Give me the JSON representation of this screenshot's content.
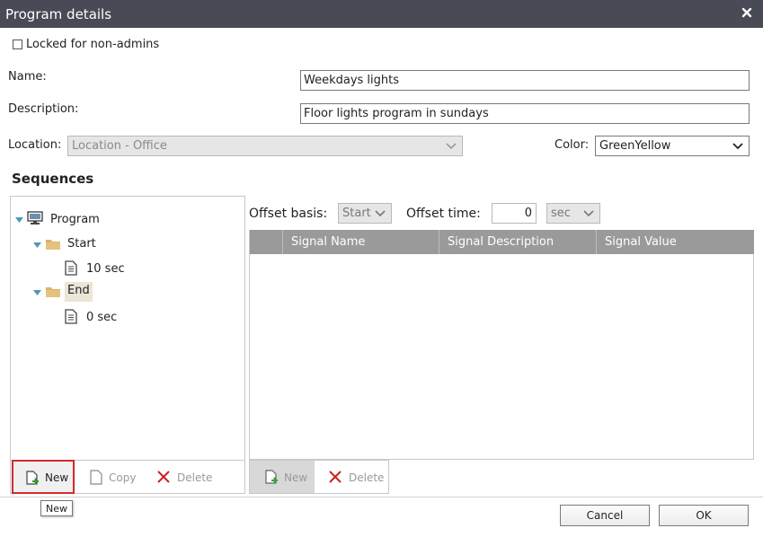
{
  "window": {
    "title": "Program details",
    "close_icon": "close-icon"
  },
  "locked": {
    "label": "Locked for non-admins",
    "checked": false
  },
  "form": {
    "name_label": "Name:",
    "name_value": "Weekdays lights",
    "description_label": "Description:",
    "description_value": "Floor lights program in sundays",
    "location_label": "Location:",
    "location_value": "Location - Office",
    "color_label": "Color:",
    "color_value": "GreenYellow"
  },
  "sequences": {
    "title": "Sequences",
    "tree": {
      "root": "Program",
      "start": "Start",
      "start_child": "10 sec",
      "end": "End",
      "end_child": "0 sec"
    },
    "offset_basis_label": "Offset basis:",
    "offset_basis_value": "Start",
    "offset_time_label": "Offset time:",
    "offset_time_value": "0",
    "offset_unit_value": "sec",
    "columns": [
      "Signal Name",
      "Signal Description",
      "Signal Value"
    ],
    "left_toolbar": {
      "new": "New",
      "copy": "Copy",
      "delete": "Delete"
    },
    "right_toolbar": {
      "new": "New",
      "delete": "Delete"
    }
  },
  "tooltip": "New",
  "footer": {
    "cancel": "Cancel",
    "ok": "OK"
  },
  "colors": {
    "titlebar": "#484a55",
    "grid_header": "#9a9a9a",
    "delete_red": "#cc1f1f",
    "new_green": "#2e9c2e",
    "highlight_border": "#d42a2a"
  }
}
